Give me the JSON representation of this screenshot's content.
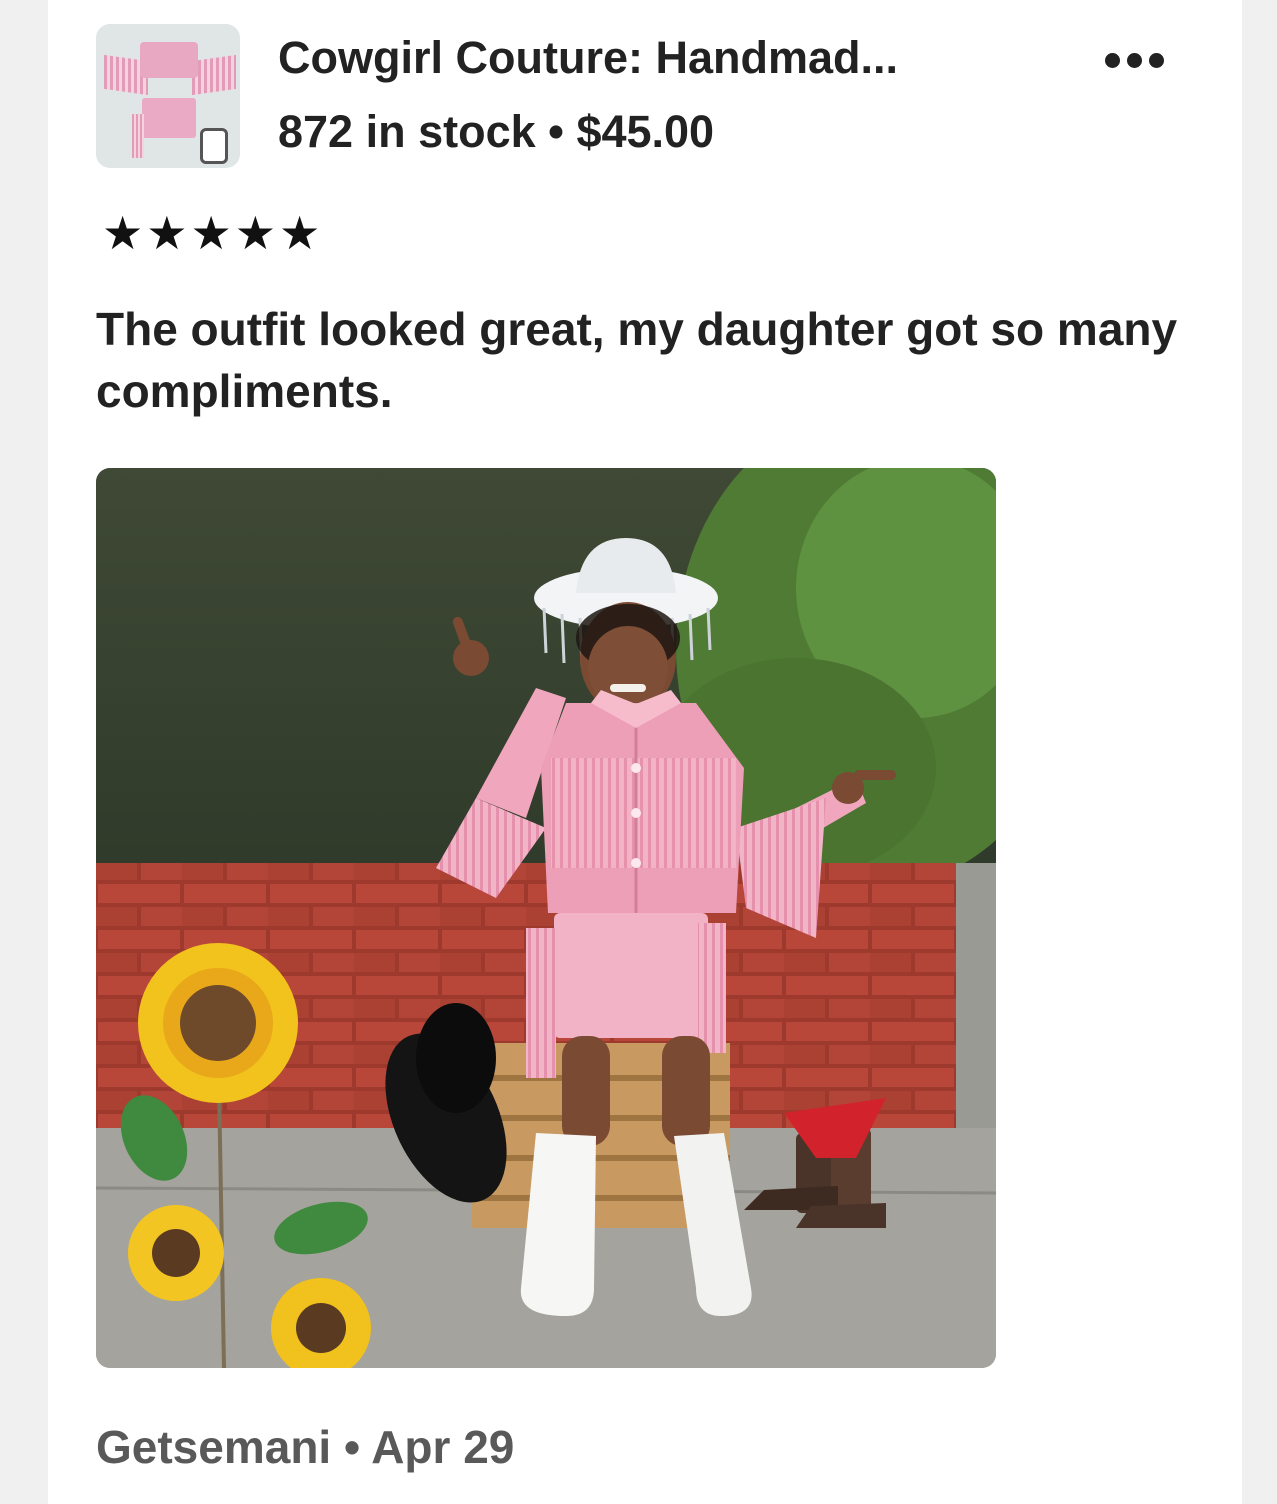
{
  "listing": {
    "title": "Cowgirl Couture: Handmad...",
    "stock_text": "872 in stock",
    "separator": "•",
    "price": "$45.00",
    "more_icon": "ellipsis-icon",
    "thumbnail_icon": "product-thumbnail"
  },
  "review": {
    "rating": 5,
    "stars_text": "★★★★★",
    "text": "The outfit looked great, my daughter got so many compliments.",
    "photo_alt": "Review photo"
  },
  "footer": {
    "author": "Getsemani",
    "separator": "•",
    "date": "Apr 29"
  }
}
